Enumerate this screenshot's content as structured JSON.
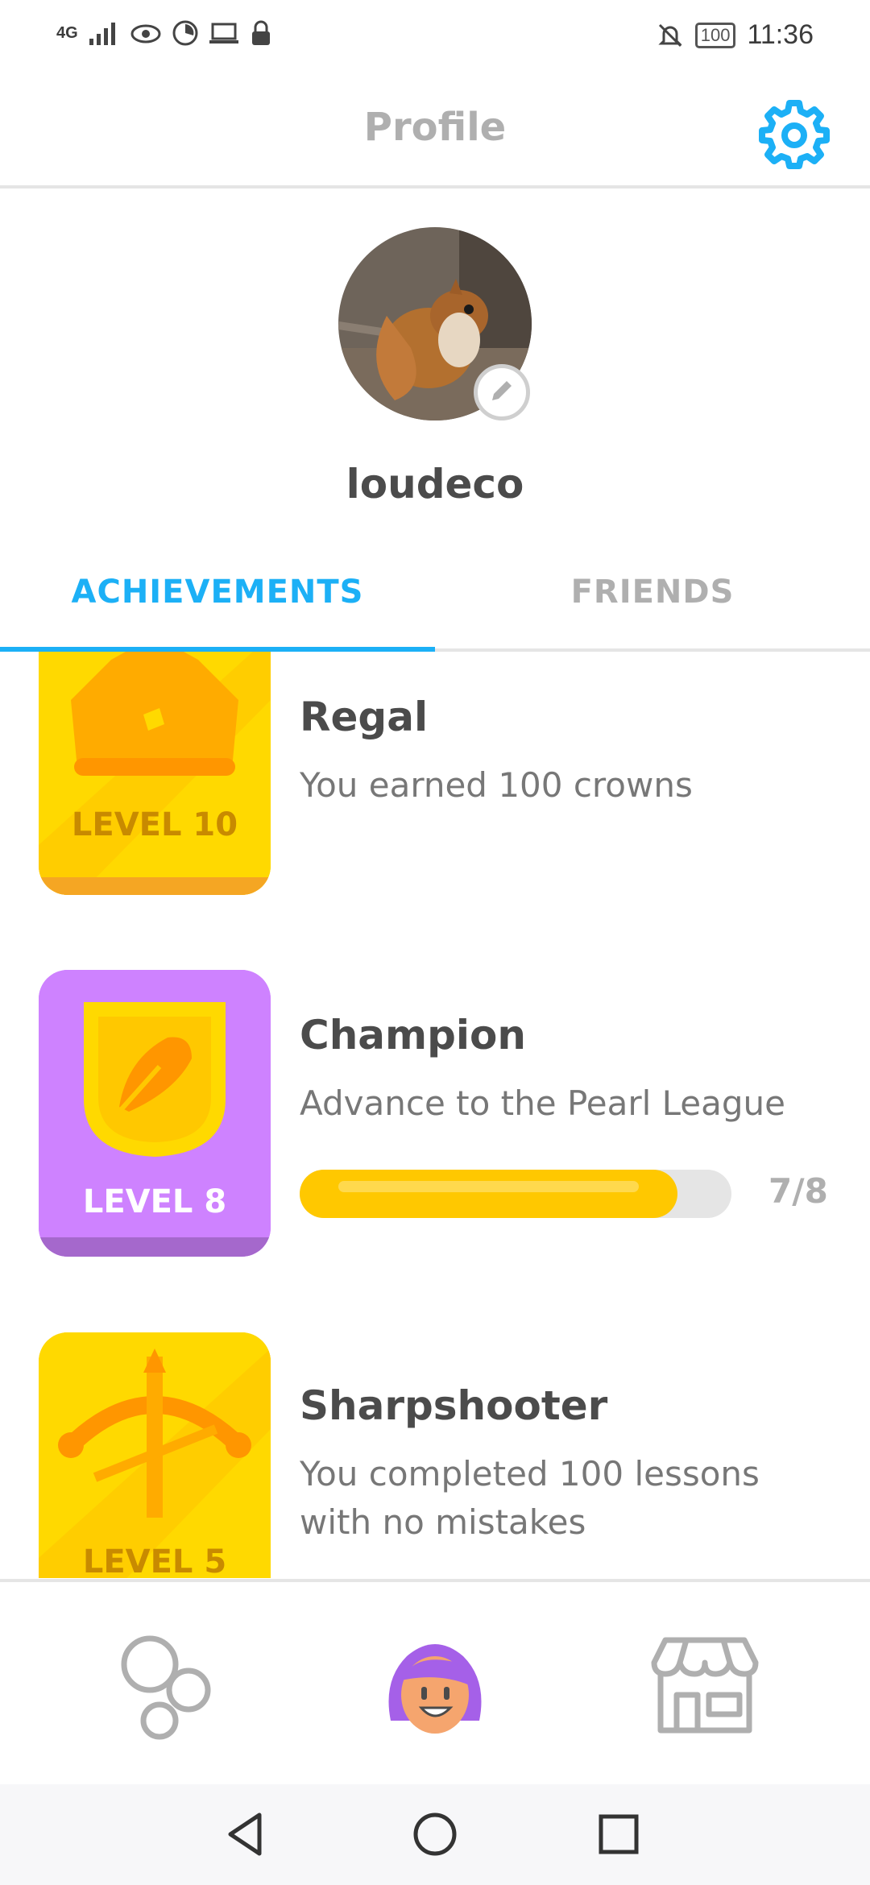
{
  "status_bar": {
    "network": "4G",
    "battery": "100",
    "time": "11:36"
  },
  "header": {
    "title": "Profile"
  },
  "profile": {
    "username": "loudeco"
  },
  "tabs": [
    {
      "label": "ACHIEVEMENTS",
      "active": true
    },
    {
      "label": "FRIENDS",
      "active": false
    }
  ],
  "achievements": [
    {
      "title": "Regal",
      "description": "You earned 100 crowns",
      "level_label": "LEVEL 10",
      "color": "#ffc800"
    },
    {
      "title": "Champion",
      "description": "Advance to the Pearl League",
      "level_label": "LEVEL 8",
      "color": "#ce82ff",
      "progress_text": "7/8",
      "progress": 0.875
    },
    {
      "title": "Sharpshooter",
      "description": "You completed 100 lessons with no mistakes",
      "level_label": "LEVEL 5",
      "color": "#ffc800"
    }
  ],
  "bottom_nav": [
    {
      "icon": "learn-bubbles-icon",
      "active": false
    },
    {
      "icon": "profile-character-icon",
      "active": true
    },
    {
      "icon": "shop-icon",
      "active": false
    }
  ],
  "colors": {
    "accent": "#1cb0f6",
    "gold": "#ffc800",
    "purple": "#ce82ff",
    "muted": "#afafaf",
    "divider": "#e5e5e5"
  }
}
